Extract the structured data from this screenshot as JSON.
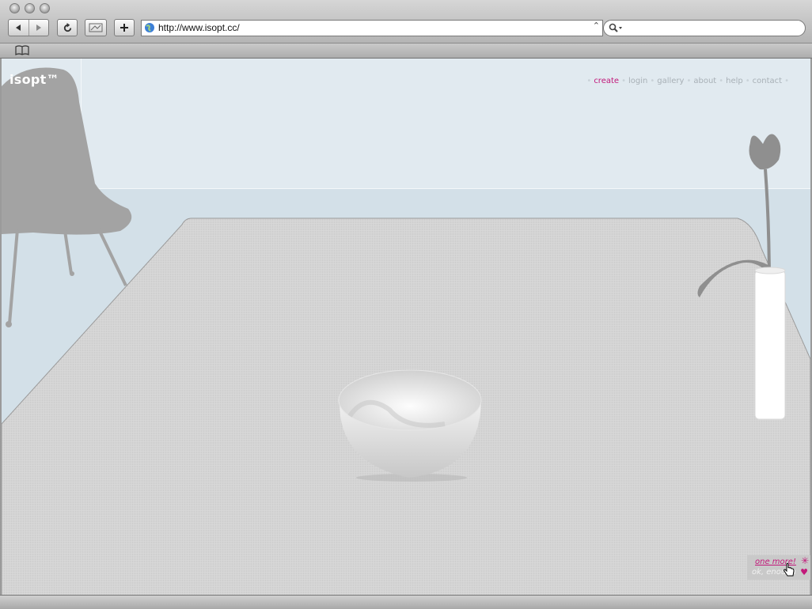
{
  "browser": {
    "url": "http://www.isopt.cc/",
    "icons": [
      "back-icon",
      "forward-icon",
      "reload-icon",
      "snapback-icon",
      "add-bookmark-icon",
      "globe-icon",
      "search-icon",
      "bookmarks-icon"
    ]
  },
  "site": {
    "logo": "isopt™",
    "nav": {
      "create": "create",
      "login": "login",
      "gallery": "gallery",
      "about": "about",
      "help": "help",
      "contact": "contact"
    },
    "promo": {
      "one_more": "one more!",
      "ok_enough": "ok, enough"
    }
  },
  "colors": {
    "accent": "#c2187a",
    "wall": "#e1eaf0",
    "table": "#d6d6d6"
  }
}
